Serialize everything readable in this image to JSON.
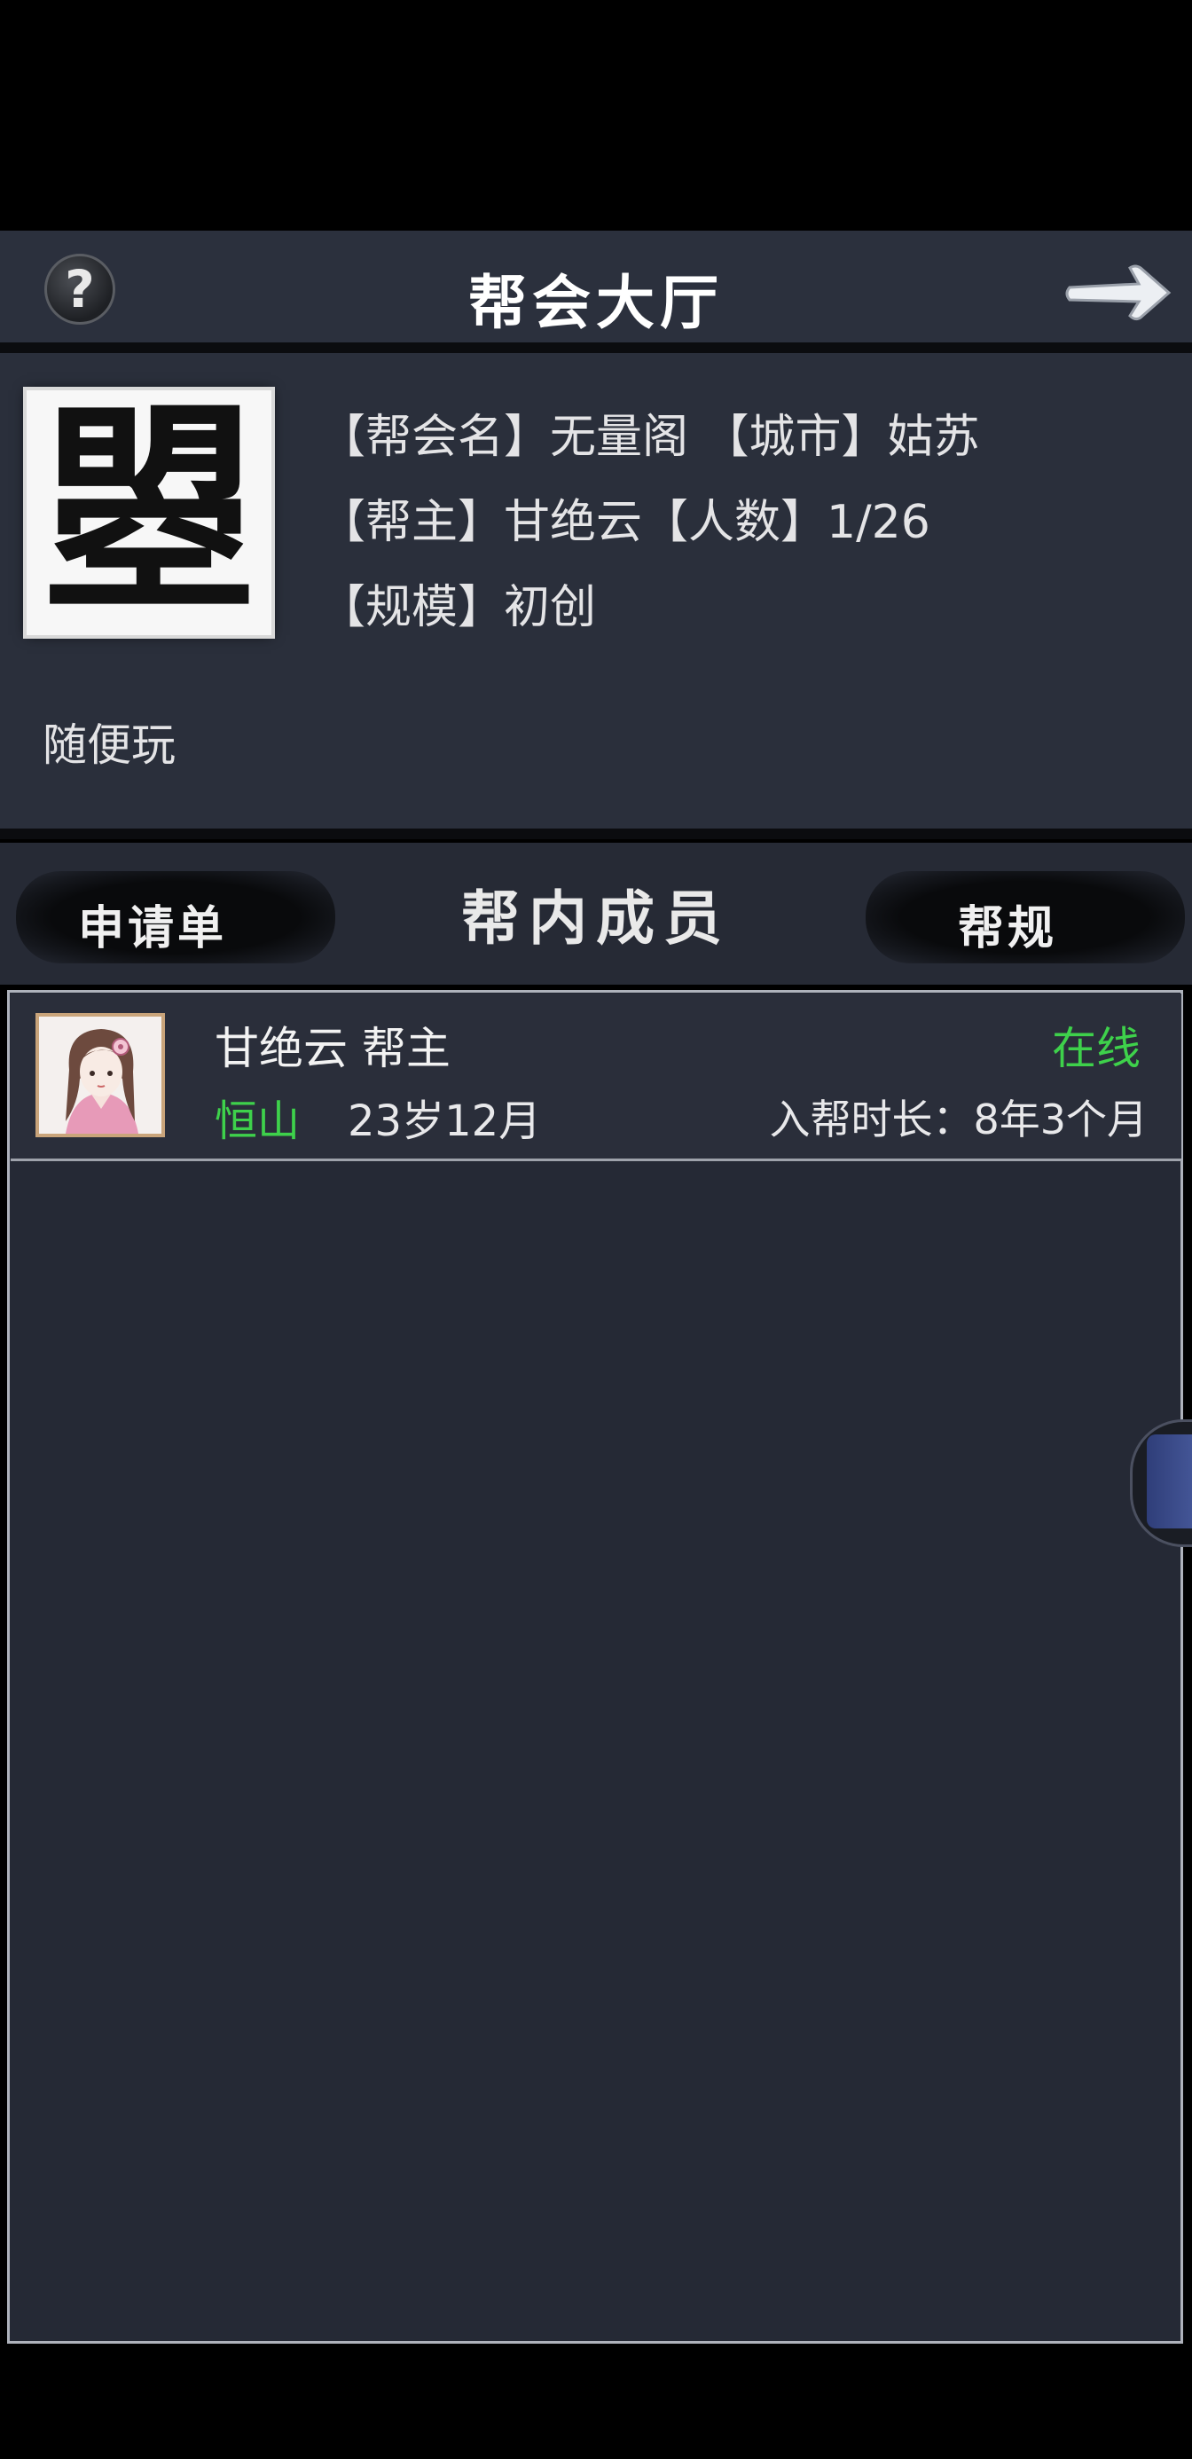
{
  "header": {
    "title": "帮会大厅",
    "help_icon": "question-mark-icon",
    "help_glyph": "?",
    "back_icon": "arrow-right-icon"
  },
  "guild": {
    "emblem_char": "曌",
    "line1": "【帮会名】无量阁 【城市】姑苏",
    "line2": "【帮主】甘绝云【人数】1/26",
    "line3": "【规模】初创",
    "motto": "随便玩"
  },
  "tabs": {
    "left": "申请单",
    "center": "帮内成员",
    "right": "帮规"
  },
  "members": [
    {
      "name_role": "甘绝云 帮主",
      "school": "恒山",
      "age": "23岁12月",
      "status": "在线",
      "join_duration": "入帮时长：8年3个月",
      "avatar_icon": "female-portrait-avatar"
    }
  ],
  "colors": {
    "accent_green": "#3ed14b",
    "panel_bg": "#2a2f3b",
    "list_bg": "#252935"
  }
}
